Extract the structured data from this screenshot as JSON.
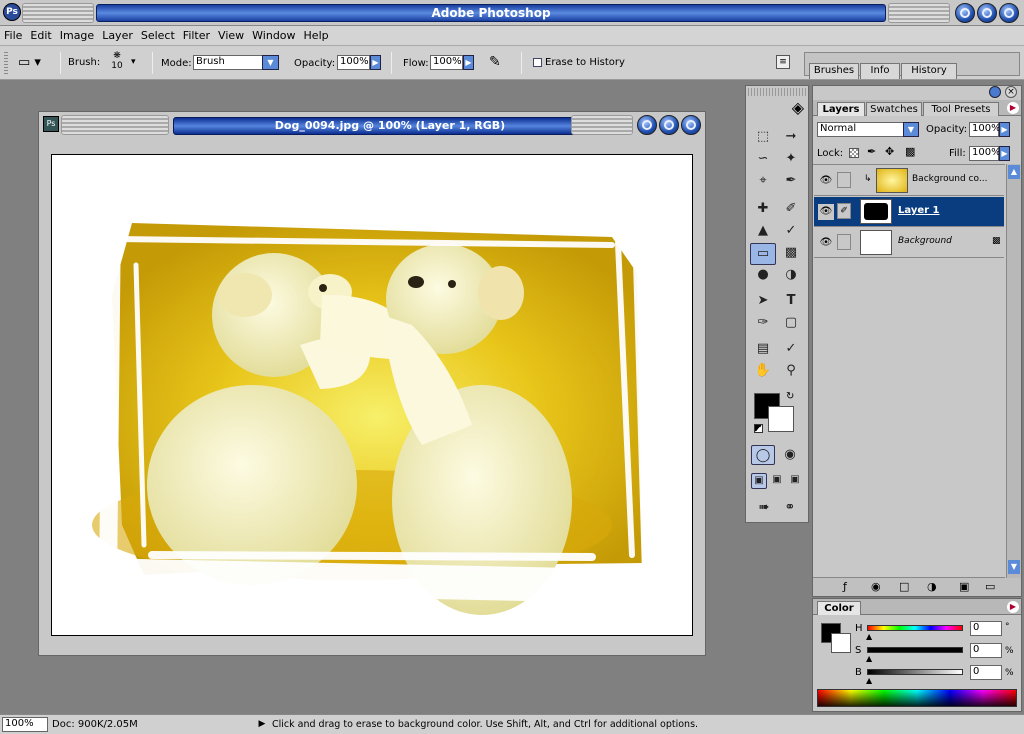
{
  "app": {
    "title": "Adobe Photoshop"
  },
  "menu": [
    "File",
    "Edit",
    "Image",
    "Layer",
    "Select",
    "Filter",
    "View",
    "Window",
    "Help"
  ],
  "options": {
    "brush_label": "Brush:",
    "brush_size": "10",
    "mode_label": "Mode:",
    "mode_value": "Brush",
    "opacity_label": "Opacity:",
    "opacity_value": "100%",
    "flow_label": "Flow:",
    "flow_value": "100%",
    "erase_history_label": "Erase to History"
  },
  "palette_well": {
    "tabs": [
      "Brushes",
      "Info",
      "History"
    ]
  },
  "document": {
    "title": "Dog_0094.jpg @ 100% (Layer 1, RGB)"
  },
  "layers_panel": {
    "tabs": [
      "Layers",
      "Swatches",
      "Tool Presets"
    ],
    "blend_mode": "Normal",
    "opacity_label": "Opacity:",
    "opacity_value": "100%",
    "lock_label": "Lock:",
    "fill_label": "Fill:",
    "fill_value": "100%",
    "layers": [
      {
        "name": "Background co..."
      },
      {
        "name": "Layer 1"
      },
      {
        "name": "Background"
      }
    ]
  },
  "color_panel": {
    "tab": "Color",
    "channels": [
      {
        "label": "H",
        "value": "0",
        "unit": "°"
      },
      {
        "label": "S",
        "value": "0",
        "unit": "%"
      },
      {
        "label": "B",
        "value": "0",
        "unit": "%"
      }
    ]
  },
  "status": {
    "zoom": "100%",
    "doc_size": "Doc: 900K/2.05M",
    "hint": "Click and drag to erase to background color.  Use Shift, Alt, and Ctrl for additional options."
  },
  "colors": {
    "title_blue": "#1a3fa0",
    "selection_blue": "#0a3d80",
    "foreground": "#000000",
    "background": "#ffffff"
  }
}
